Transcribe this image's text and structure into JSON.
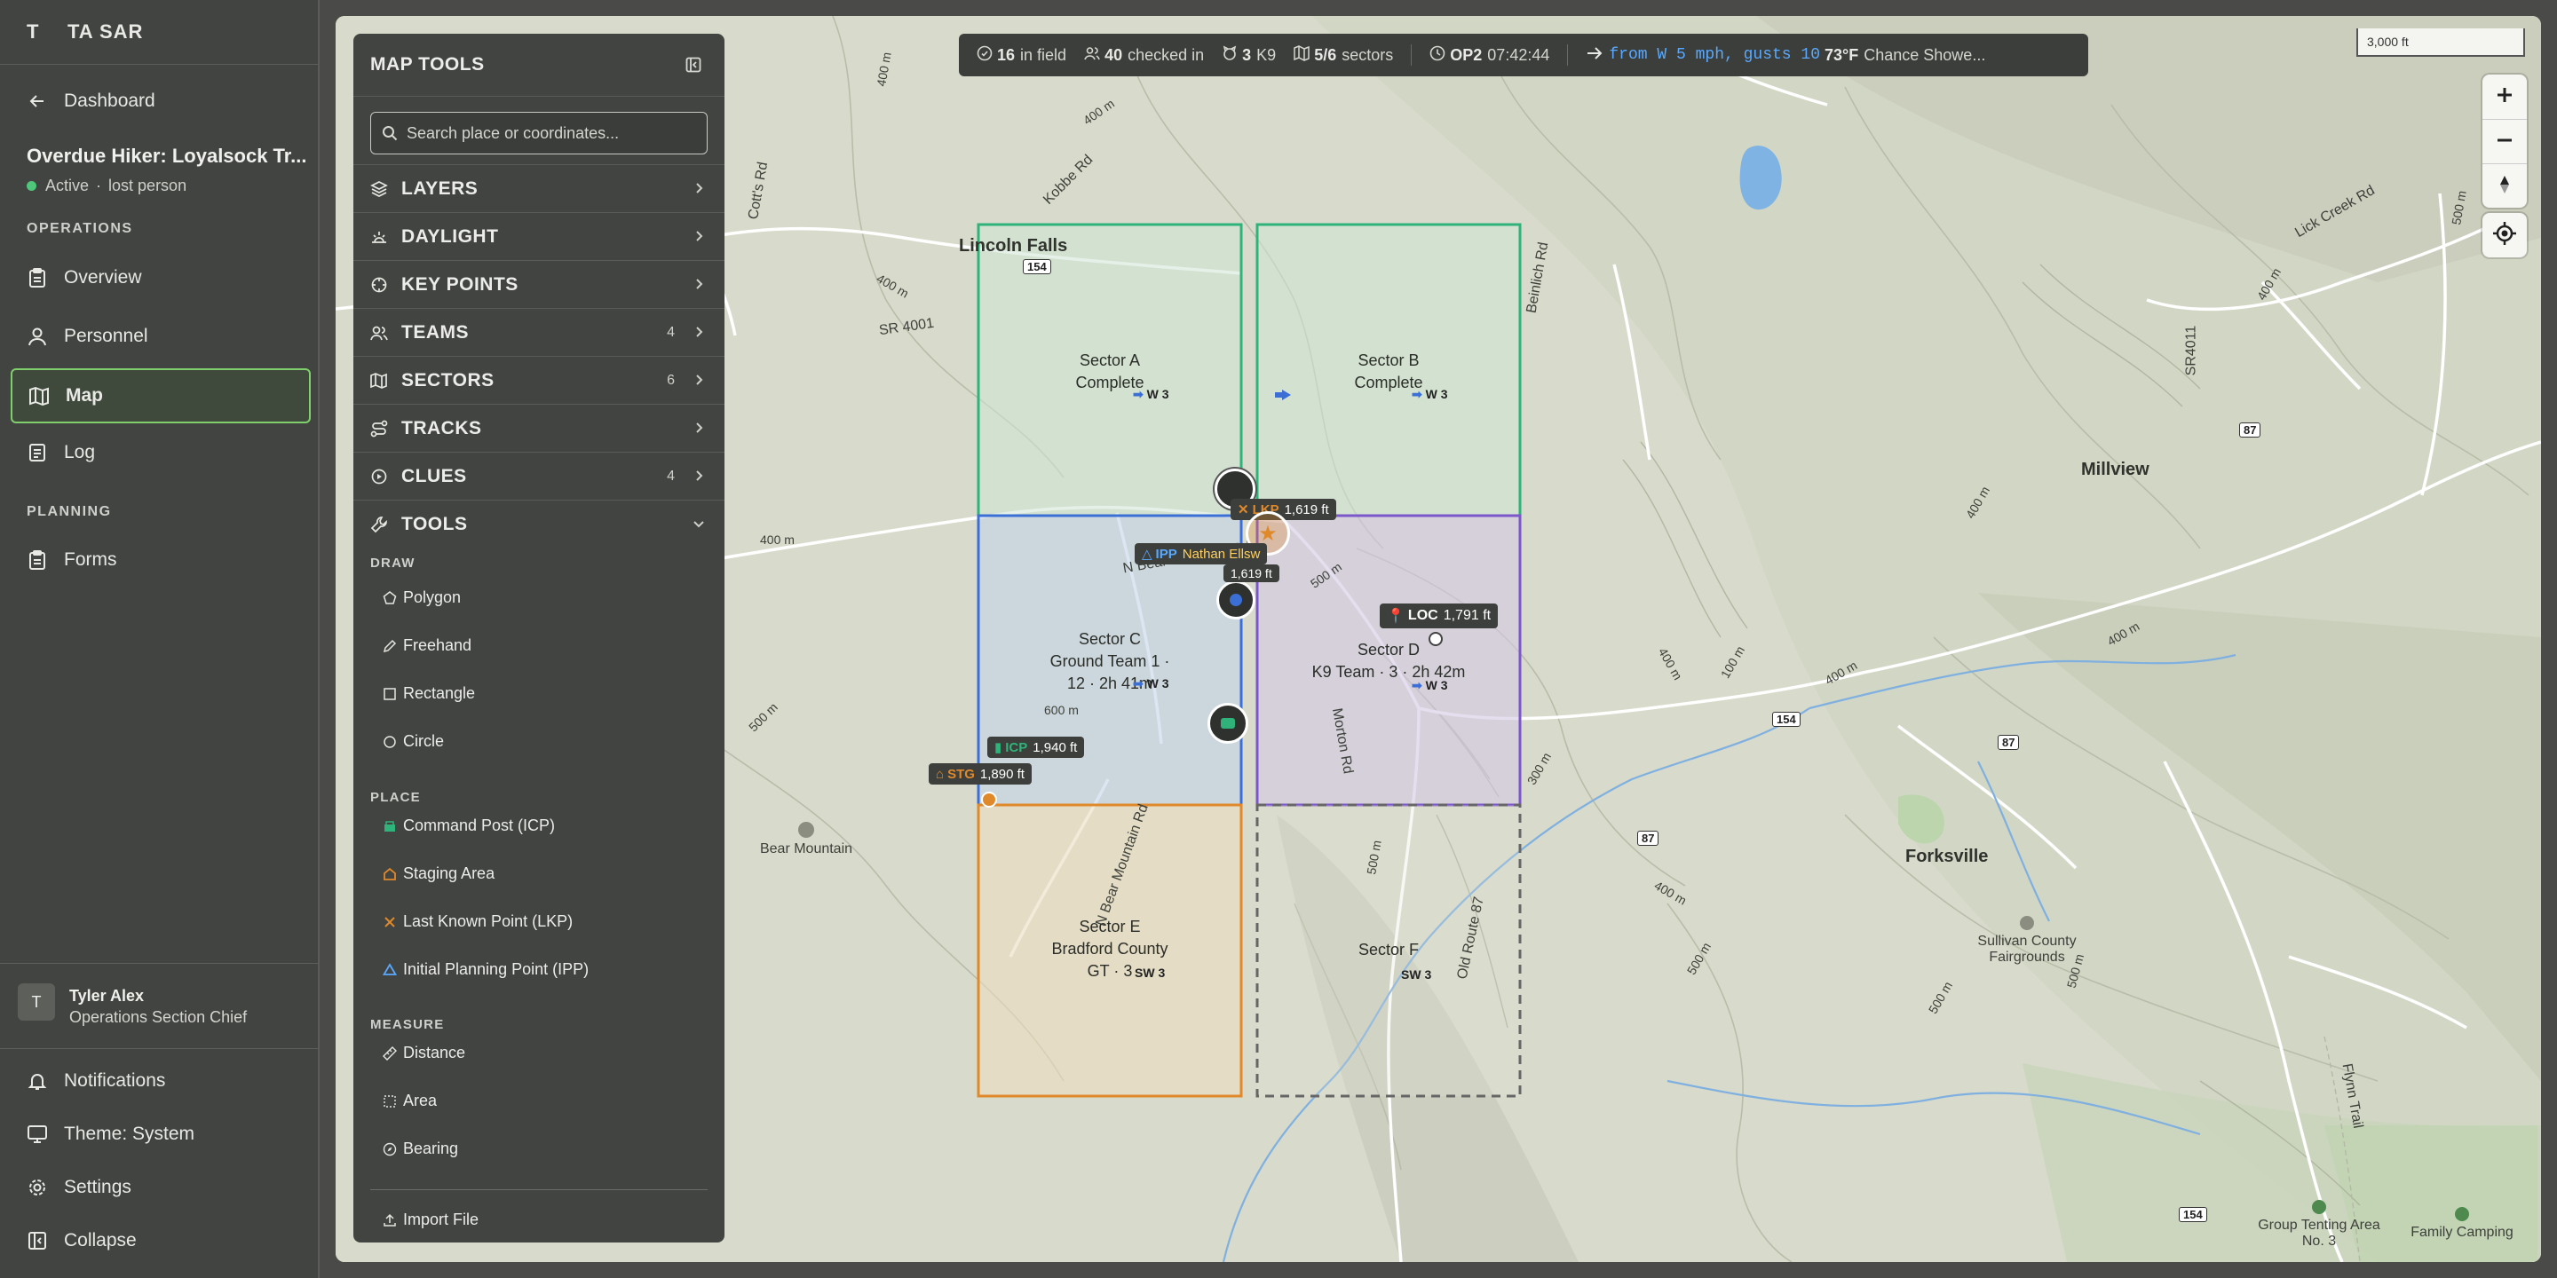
{
  "app": {
    "logo": "T",
    "org": "TA SAR"
  },
  "sidebar": {
    "back_label": "Dashboard",
    "incident": {
      "title": "Overdue Hiker: Loyalsock Tr...",
      "status": "Active",
      "type": "lost person"
    },
    "operations_label": "OPERATIONS",
    "operations_items": [
      "Overview",
      "Personnel",
      "Map",
      "Log"
    ],
    "planning_label": "PLANNING",
    "planning_items": [
      "Forms"
    ],
    "user": {
      "initial": "T",
      "name": "Tyler Alex",
      "role": "Operations Section Chief"
    },
    "footer_items": [
      "Notifications",
      "Theme: System",
      "Settings",
      "Collapse"
    ]
  },
  "map_tools": {
    "title": "MAP TOOLS",
    "search_placeholder": "Search place or coordinates...",
    "sections": [
      {
        "label": "LAYERS",
        "count": ""
      },
      {
        "label": "DAYLIGHT",
        "count": ""
      },
      {
        "label": "KEY POINTS",
        "count": ""
      },
      {
        "label": "TEAMS",
        "count": "4"
      },
      {
        "label": "SECTORS",
        "count": "6"
      },
      {
        "label": "TRACKS",
        "count": ""
      },
      {
        "label": "CLUES",
        "count": "4"
      },
      {
        "label": "TOOLS",
        "count": ""
      }
    ],
    "draw_label": "DRAW",
    "draw_items": [
      "Polygon",
      "Freehand",
      "Rectangle",
      "Circle"
    ],
    "place_label": "PLACE",
    "place_items": [
      "Command Post (ICP)",
      "Staging Area",
      "Last Known Point (LKP)",
      "Initial Planning Point (IPP)"
    ],
    "measure_label": "MEASURE",
    "measure_items": [
      "Distance",
      "Area",
      "Bearing"
    ],
    "import_label": "Import File"
  },
  "status": {
    "in_field_count": "16",
    "in_field_label": "in field",
    "checked_in_count": "40",
    "checked_in_label": "checked in",
    "k9_count": "3",
    "k9_label": "K9",
    "sectors_value": "5/6",
    "sectors_label": "sectors",
    "op_label": "OP2",
    "op_clock": "07:42:44",
    "wind": "from W 5 mph, gusts 10",
    "temp": "73°F",
    "forecast": "Chance Showe..."
  },
  "map": {
    "scale": "3,000 ft",
    "places": [
      "Lincoln Falls",
      "Millview",
      "Forksville"
    ],
    "roads": [
      "SR 4001",
      "N Bear Mountain Rd",
      "N Bear Mountain Rd",
      "Kobbe Rd",
      "Cott's Rd",
      "Beinlich Rd",
      "Lick Creek Rd",
      "SR4011",
      "Old Route 87",
      "Morton Rd",
      "Flynn Trail"
    ],
    "shields": [
      "154",
      "87",
      "154",
      "87",
      "87",
      "154"
    ],
    "pois": [
      "Bear Mountain",
      "Sullivan County Fairgrounds",
      "Group Tenting Area No. 3",
      "Family Camping"
    ],
    "contours": [
      "400 m",
      "400 m",
      "400 m",
      "500 m",
      "600 m",
      "500 m",
      "400 m",
      "500 m",
      "400 m",
      "500 m",
      "400 m",
      "400 m",
      "500 m",
      "400 m",
      "300 m",
      "400 m",
      "500 m",
      "400 m",
      "500 m",
      "100 m"
    ],
    "sectors": [
      {
        "name": "Sector A",
        "status": "Complete",
        "wind": "W 3"
      },
      {
        "name": "Sector B",
        "status": "Complete",
        "wind": "W 3"
      },
      {
        "name": "Sector C",
        "status": "Ground Team 1 ·",
        "status2": "12 · 2h 41m",
        "wind": "W 3"
      },
      {
        "name": "Sector D",
        "status": "K9 Team · 3 · 2h 42m",
        "wind": "W 3"
      },
      {
        "name": "Sector E",
        "status": "Bradford County",
        "status2": "GT · 3",
        "wind": "SW 3"
      },
      {
        "name": "Sector F",
        "status": "",
        "wind": "SW 3"
      }
    ],
    "markers": {
      "lkp": {
        "tag": "LKP",
        "elev": "1,619 ft"
      },
      "ipp": {
        "tag": "IPP",
        "name": "Nathan Ellsw",
        "elev": "1,619 ft"
      },
      "loc": {
        "tag": "LOC",
        "elev": "1,791 ft"
      },
      "icp": {
        "tag": "ICP",
        "elev": "1,940 ft"
      },
      "stg": {
        "tag": "STG",
        "elev": "1,890 ft"
      }
    },
    "colors": {
      "sector_green": "#2fb37a",
      "sector_blue": "#3b6fd6",
      "sector_purple": "#7b57c9",
      "sector_orange": "#e0892b",
      "accent": "#7fcf6c"
    }
  }
}
